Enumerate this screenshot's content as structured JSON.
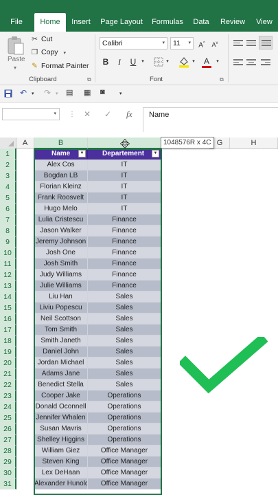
{
  "ribbon_tabs": [
    "File",
    "Home",
    "Insert",
    "Page Layout",
    "Formulas",
    "Data",
    "Review",
    "View"
  ],
  "clipboard": {
    "paste_label": "Paste",
    "cut_label": "Cut",
    "copy_label": "Copy",
    "format_painter_label": "Format Painter",
    "group_label": "Clipboard"
  },
  "font": {
    "name": "Calibri",
    "size": "11",
    "grow_label": "A",
    "shrink_label": "A",
    "bold_label": "B",
    "italic_label": "I",
    "underline_label": "U",
    "font_color_label": "A",
    "group_label": "Font",
    "fill_color": "#f6e600",
    "font_color": "#d00000"
  },
  "formula_bar": {
    "name_box": "",
    "cancel_label": "✕",
    "enter_label": "✓",
    "fx_label": "fx",
    "content": "Name"
  },
  "columns": [
    "A",
    "B",
    "",
    "G",
    "H"
  ],
  "selection_tooltip": "1048576R x 4C",
  "table": {
    "headers": [
      "Name",
      "Departement"
    ],
    "header_color": "#4b2f9c",
    "rows": [
      [
        "Alex Cos",
        "IT"
      ],
      [
        "Bogdan LB",
        "IT"
      ],
      [
        "Florian Kleinz",
        "IT"
      ],
      [
        "Frank Roosvelt",
        "IT"
      ],
      [
        "Hugo Melo",
        "IT"
      ],
      [
        "Lulia Cristescu",
        "Finance"
      ],
      [
        "Jason Walker",
        "Finance"
      ],
      [
        "Jeremy Johnson",
        "Finance"
      ],
      [
        "Josh One",
        "Finance"
      ],
      [
        "Josh Smith",
        "Finance"
      ],
      [
        "Judy Williams",
        "Finance"
      ],
      [
        "Julie Williams",
        "Finance"
      ],
      [
        "Liu Han",
        "Sales"
      ],
      [
        "Liviu Popescu",
        "Sales"
      ],
      [
        "Neil Scottson",
        "Sales"
      ],
      [
        "Tom Smith",
        "Sales"
      ],
      [
        "Smith Janeth",
        "Sales"
      ],
      [
        "Daniel John",
        "Sales"
      ],
      [
        "Jordan Michael",
        "Sales"
      ],
      [
        "Adams Jane",
        "Sales"
      ],
      [
        "Benedict Stella",
        "Sales"
      ],
      [
        "Cooper Jake",
        "Operations"
      ],
      [
        "Donald Oconnell",
        "Operations"
      ],
      [
        "Jennifer Whalen",
        "Operations"
      ],
      [
        "Susan Mavris",
        "Operations"
      ],
      [
        "Shelley Higgins",
        "Operations"
      ],
      [
        "William Giez",
        "Office Manager"
      ],
      [
        "Steven King",
        "Office Manager"
      ],
      [
        "Lex DeHaan",
        "Office Manager"
      ],
      [
        "Alexander Hunold",
        "Office Manager"
      ]
    ]
  },
  "row_numbers": [
    "1",
    "2",
    "3",
    "4",
    "5",
    "6",
    "7",
    "8",
    "9",
    "10",
    "11",
    "12",
    "13",
    "14",
    "15",
    "16",
    "17",
    "18",
    "19",
    "20",
    "21",
    "22",
    "23",
    "24",
    "25",
    "26",
    "27",
    "28",
    "29",
    "30",
    "31"
  ],
  "accent_color": "#217346",
  "checkmark_color": "#1fbf55"
}
